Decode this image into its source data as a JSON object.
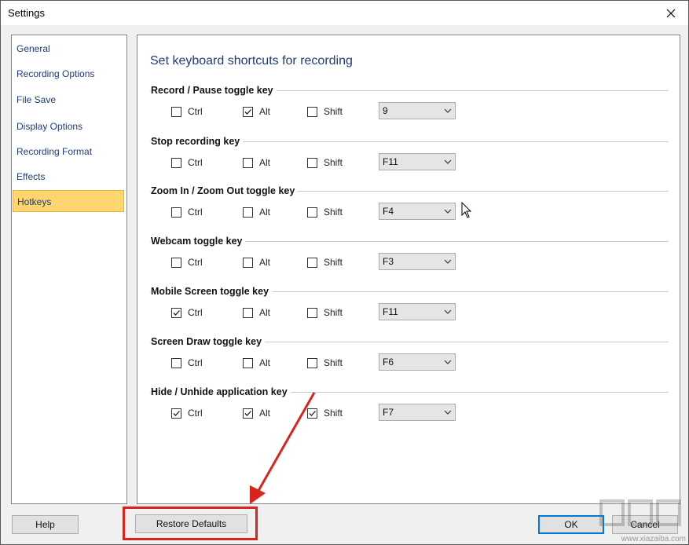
{
  "window": {
    "title": "Settings"
  },
  "sidebar": {
    "items": [
      {
        "label": "General",
        "active": false
      },
      {
        "label": "Recording Options",
        "active": false
      },
      {
        "label": "File Save",
        "active": false
      },
      {
        "label": "Display Options",
        "active": false
      },
      {
        "label": "Recording Format",
        "active": false
      },
      {
        "label": "Effects",
        "active": false
      },
      {
        "label": "Hotkeys",
        "active": true
      }
    ]
  },
  "main": {
    "heading": "Set keyboard shortcuts for recording",
    "modifier_labels": {
      "ctrl": "Ctrl",
      "alt": "Alt",
      "shift": "Shift"
    },
    "hotkeys": [
      {
        "label": "Record / Pause toggle key",
        "ctrl": false,
        "alt": true,
        "shift": false,
        "key": "9"
      },
      {
        "label": "Stop recording key",
        "ctrl": false,
        "alt": false,
        "shift": false,
        "key": "F11"
      },
      {
        "label": "Zoom In / Zoom Out toggle key",
        "ctrl": false,
        "alt": false,
        "shift": false,
        "key": "F4"
      },
      {
        "label": "Webcam toggle key",
        "ctrl": false,
        "alt": false,
        "shift": false,
        "key": "F3"
      },
      {
        "label": "Mobile Screen toggle key",
        "ctrl": true,
        "alt": false,
        "shift": false,
        "key": "F11"
      },
      {
        "label": "Screen Draw toggle key",
        "ctrl": false,
        "alt": false,
        "shift": false,
        "key": "F6"
      },
      {
        "label": "Hide / Unhide application key",
        "ctrl": true,
        "alt": true,
        "shift": true,
        "key": "F7"
      }
    ]
  },
  "footer": {
    "help_label": "Help",
    "restore_label": "Restore Defaults",
    "ok_label": "OK",
    "cancel_label": "Cancel"
  },
  "annotation": {
    "highlight_color": "#d9241c"
  },
  "watermark": {
    "text": "www.xiazaiba.com"
  },
  "colors": {
    "accent": "#0078d7",
    "active_item": "#ffd66e",
    "link_text": "#1e3c78"
  }
}
